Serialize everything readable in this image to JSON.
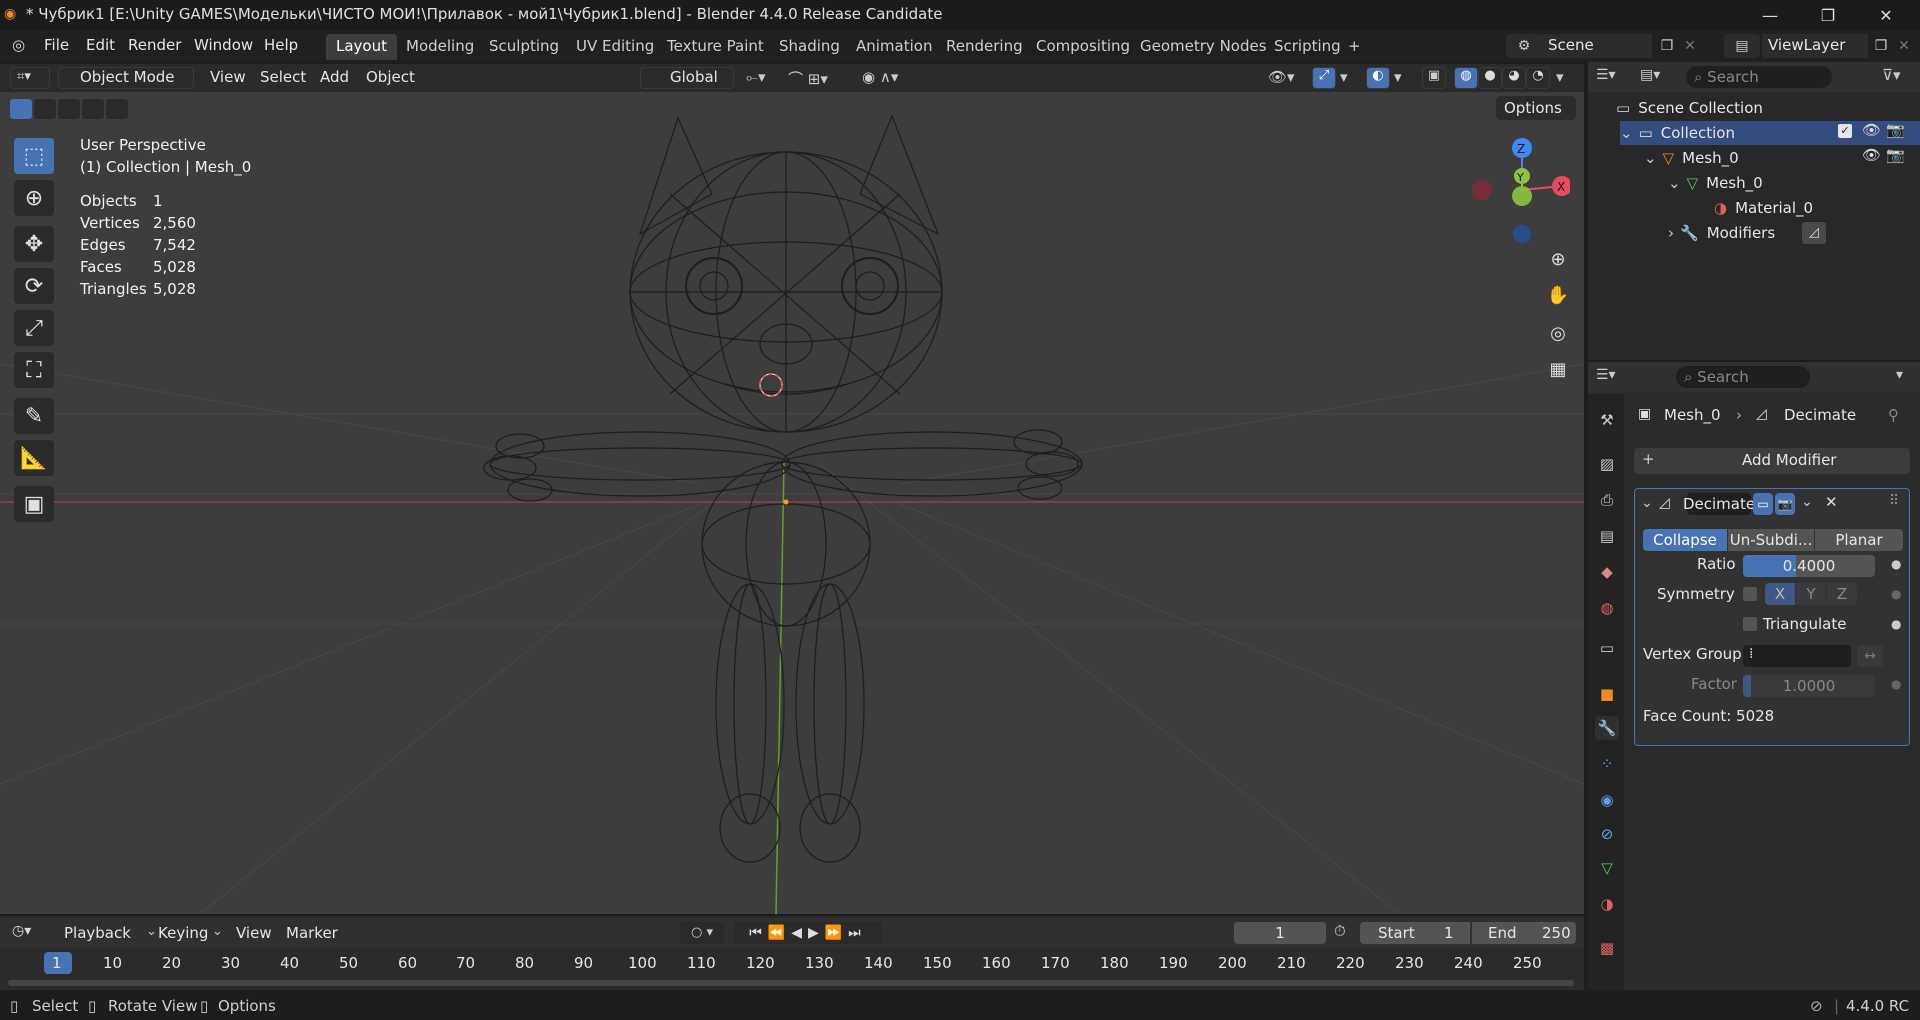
{
  "window": {
    "title": "* Чубрик1 [E:\\Unity GAMES\\Модельки\\ЧИСТО МОИ!\\Прилавок - мой1\\Чубрик1.blend] - Blender 4.4.0 Release Candidate",
    "minimize": "—",
    "maximize": "❐",
    "close": "✕"
  },
  "menubar": {
    "items": [
      "File",
      "Edit",
      "Render",
      "Window",
      "Help"
    ],
    "workspaces": [
      "Layout",
      "Modeling",
      "Sculpting",
      "UV Editing",
      "Texture Paint",
      "Shading",
      "Animation",
      "Rendering",
      "Compositing",
      "Geometry Nodes",
      "Scripting"
    ],
    "add_tab": "+",
    "scene": "Scene",
    "view_layer": "ViewLayer"
  },
  "viewport_header": {
    "mode": "Object Mode",
    "menus": [
      "View",
      "Select",
      "Add",
      "Object"
    ],
    "transform_orientation": "Global",
    "options": "Options"
  },
  "overlay": {
    "view_name": "User Perspective",
    "context": "(1) Collection | Mesh_0",
    "stats": [
      {
        "label": "Objects",
        "value": "1"
      },
      {
        "label": "Vertices",
        "value": "2,560"
      },
      {
        "label": "Edges",
        "value": "7,542"
      },
      {
        "label": "Faces",
        "value": "5,028"
      },
      {
        "label": "Triangles",
        "value": "5,028"
      }
    ]
  },
  "gizmo": {
    "z": "Z",
    "x": "X",
    "y": "Y"
  },
  "outliner": {
    "search_placeholder": "Search",
    "scene_collection": "Scene Collection",
    "collection": "Collection",
    "object": "Mesh_0",
    "mesh": "Mesh_0",
    "material": "Material_0",
    "modifiers": "Modifiers"
  },
  "properties": {
    "search_placeholder": "Search",
    "breadcrumb_object": "Mesh_0",
    "breadcrumb_modifier": "Decimate",
    "add_modifier": "Add Modifier",
    "modifier_name": "Decimate",
    "modes": [
      "Collapse",
      "Un-Subdi...",
      "Planar"
    ],
    "ratio_label": "Ratio",
    "ratio_value": "0.4000",
    "ratio": 0.4,
    "symmetry_label": "Symmetry",
    "axes": [
      "X",
      "Y",
      "Z"
    ],
    "triangulate_label": "Triangulate",
    "vertex_group_label": "Vertex Group",
    "factor_label": "Factor",
    "factor_value": "1.0000",
    "face_count": "Face Count: 5028"
  },
  "timeline": {
    "menus": [
      "Playback",
      "Keying",
      "View",
      "Marker"
    ],
    "current_frame": "1",
    "start_label": "Start",
    "start_value": "1",
    "end_label": "End",
    "end_value": "250",
    "ruler": [
      "1",
      "10",
      "20",
      "30",
      "40",
      "50",
      "60",
      "70",
      "80",
      "90",
      "100",
      "110",
      "120",
      "130",
      "140",
      "150",
      "160",
      "170",
      "180",
      "190",
      "200",
      "210",
      "220",
      "230",
      "240",
      "250"
    ]
  },
  "statusbar": {
    "select": "Select",
    "rotate": "Rotate View",
    "options": "Options",
    "version": "4.4.0 RC"
  },
  "colors": {
    "accent": "#4772b3",
    "axis_x": "#e84a5f",
    "axis_y": "#8cc43f",
    "axis_z": "#3d8af7"
  }
}
